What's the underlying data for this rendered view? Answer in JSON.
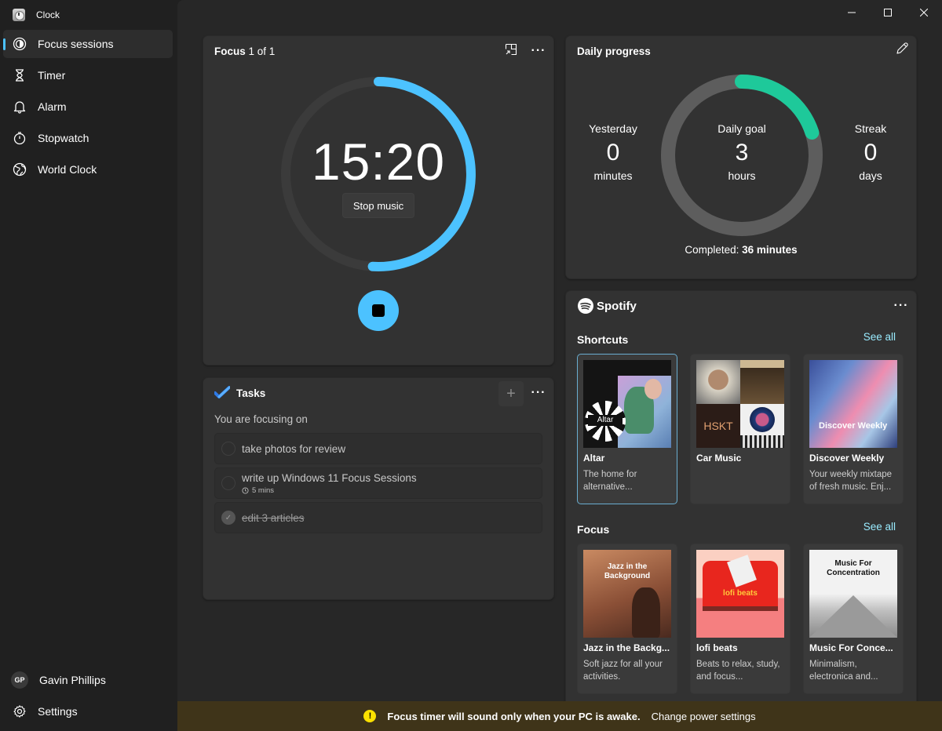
{
  "app": {
    "title": "Clock"
  },
  "window_controls": {
    "minimize": "minimize",
    "maximize": "maximize",
    "close": "close"
  },
  "sidebar": {
    "items": [
      {
        "label": "Focus sessions",
        "icon": "focus-icon",
        "active": true
      },
      {
        "label": "Timer",
        "icon": "hourglass-icon",
        "active": false
      },
      {
        "label": "Alarm",
        "icon": "bell-icon",
        "active": false
      },
      {
        "label": "Stopwatch",
        "icon": "stopwatch-icon",
        "active": false
      },
      {
        "label": "World Clock",
        "icon": "globe-icon",
        "active": false
      }
    ],
    "user": {
      "initials": "GP",
      "name": "Gavin Phillips"
    },
    "settings_label": "Settings"
  },
  "focus": {
    "title_bold": "Focus",
    "title_rest": " 1 of 1",
    "time_remaining": "15:20",
    "remaining_fraction": 0.51,
    "stop_music_label": "Stop music",
    "accent_color": "#4cc2ff"
  },
  "tasks": {
    "title": "Tasks",
    "add_label": "+",
    "focusing_label": "You are focusing on",
    "items": [
      {
        "text": "take photos for review",
        "done": false,
        "duration": ""
      },
      {
        "text": "write up Windows 11 Focus Sessions",
        "done": false,
        "duration": "5 mins"
      },
      {
        "text": "edit 3 articles",
        "done": true,
        "duration": ""
      }
    ]
  },
  "daily_progress": {
    "title": "Daily progress",
    "yesterday": {
      "label": "Yesterday",
      "value": "0",
      "unit": "minutes"
    },
    "goal": {
      "label": "Daily goal",
      "value": "3",
      "unit": "hours"
    },
    "streak": {
      "label": "Streak",
      "value": "0",
      "unit": "days"
    },
    "completed_label": "Completed:",
    "completed_value": "36 minutes",
    "completed_fraction": 0.2,
    "accent_color": "#1ec99a"
  },
  "spotify": {
    "brand": "Spotify",
    "shortcuts": {
      "title": "Shortcuts",
      "see_all": "See all",
      "items": [
        {
          "name": "Altar",
          "desc": "The home for alternative...",
          "selected": true
        },
        {
          "name": "Car Music",
          "desc": "",
          "selected": false
        },
        {
          "name": "Discover Weekly",
          "desc": "Your weekly mixtape of fresh music. Enj...",
          "selected": false,
          "art_text": "Discover Weekly"
        }
      ]
    },
    "focus": {
      "title": "Focus",
      "see_all": "See all",
      "items": [
        {
          "name": "Jazz in the Backg...",
          "desc": "Soft jazz for all your activities.",
          "art_text": "Jazz in the Background"
        },
        {
          "name": "lofi beats",
          "desc": "Beats to relax, study, and focus...",
          "art_text": "lofi beats"
        },
        {
          "name": "Music For Conce...",
          "desc": "Minimalism, electronica and...",
          "art_text": "Music For Concentration"
        }
      ]
    }
  },
  "notice": {
    "icon": "!",
    "message": "Focus timer will sound only when your PC is awake.",
    "link": "Change power settings"
  }
}
